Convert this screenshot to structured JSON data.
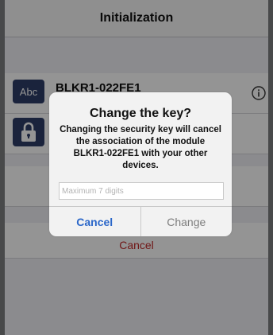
{
  "navbar": {
    "title": "Initialization"
  },
  "device": {
    "tile_label": "Abc",
    "name": "BLKR1-022FE1",
    "info_icon": "info-icon",
    "lock_icon": "lock-icon"
  },
  "behind": {
    "cancel_label": "Cancel"
  },
  "alert": {
    "title": "Change the key?",
    "message": "Changing the security key will cancel the association of the module BLKR1-022FE1 with your other devices.",
    "input_placeholder": "Maximum 7 digits",
    "cancel_label": "Cancel",
    "change_label": "Change"
  },
  "colors": {
    "accent": "#2b67c9",
    "destructive": "#c22a2a",
    "tile": "#2d3d68"
  }
}
